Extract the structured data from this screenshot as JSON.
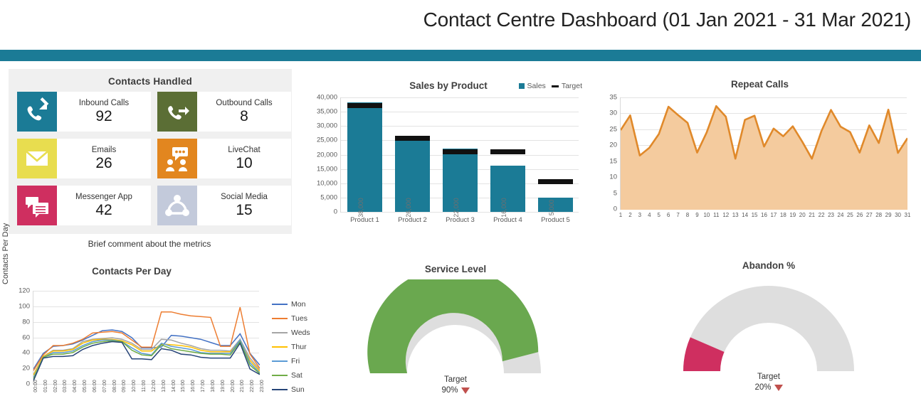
{
  "header": {
    "title": "Contact Centre Dashboard (01 Jan 2021 - 31 Mar 2021)",
    "bar_color": "#1b7b96"
  },
  "contacts_handled": {
    "title": "Contacts Handled",
    "comment": "Brief comment about the metrics",
    "tiles": [
      {
        "label": "Inbound Calls",
        "value": "92",
        "icon": "phone-inbound-icon",
        "color": "#1b7b96"
      },
      {
        "label": "Outbound Calls",
        "value": "8",
        "icon": "phone-outbound-icon",
        "color": "#5b6e35"
      },
      {
        "label": "Emails",
        "value": "26",
        "icon": "envelope-icon",
        "color": "#e8dd4f"
      },
      {
        "label": "LiveChat",
        "value": "10",
        "icon": "livechat-icon",
        "color": "#e2861f"
      },
      {
        "label": "Messenger App",
        "value": "42",
        "icon": "messenger-icon",
        "color": "#cf2f60"
      },
      {
        "label": "Social Media",
        "value": "15",
        "icon": "social-media-icon",
        "color": "#c3cadb"
      }
    ]
  },
  "chart_data": [
    {
      "id": "sales_by_product",
      "type": "bar",
      "title": "Sales by Product",
      "categories": [
        "Product 1",
        "Product 2",
        "Product 3",
        "Product 4",
        "Product 5"
      ],
      "series": [
        {
          "name": "Sales",
          "values": [
            38000,
            26000,
            22000,
            16000,
            5000
          ],
          "color": "#1b7b96"
        },
        {
          "name": "Target",
          "values": [
            37000,
            25500,
            20800,
            20800,
            10600
          ],
          "color": "#111111"
        }
      ],
      "data_labels": [
        "38,000",
        "26,000",
        "22,000",
        "16,000",
        "5,000"
      ],
      "ylabel": "",
      "xlabel": "",
      "ylim": [
        0,
        40000
      ],
      "yticks": [
        "0",
        "5,000",
        "10,000",
        "15,000",
        "20,000",
        "25,000",
        "30,000",
        "35,000",
        "40,000"
      ],
      "grid": true,
      "legend_position": "top-right"
    },
    {
      "id": "repeat_calls",
      "type": "area",
      "title": "Repeat Calls",
      "x": [
        "1",
        "2",
        "3",
        "4",
        "5",
        "6",
        "7",
        "8",
        "9",
        "10",
        "11",
        "12",
        "13",
        "14",
        "15",
        "16",
        "17",
        "18",
        "19",
        "20",
        "21",
        "22",
        "23",
        "24",
        "25",
        "26",
        "27",
        "28",
        "29",
        "30",
        "31"
      ],
      "values": [
        24.8,
        29.4,
        16.9,
        19.3,
        23.6,
        32.1,
        29.5,
        27.1,
        17.8,
        24.1,
        32.3,
        29.0,
        15.9,
        28.0,
        29.3,
        19.7,
        25.3,
        22.9,
        26.0,
        21.2,
        15.9,
        24.5,
        31.1,
        25.9,
        24.2,
        17.8,
        26.3,
        20.8,
        31.2,
        17.7,
        22.3
      ],
      "line_color": "#e0892a",
      "fill_color": "#f4cb9e",
      "ylabel": "",
      "xlabel": "",
      "ylim": [
        0,
        35
      ],
      "yticks": [
        "0",
        "5",
        "10",
        "15",
        "20",
        "25",
        "30",
        "35"
      ],
      "grid": true,
      "legend_position": "none"
    },
    {
      "id": "contacts_per_day",
      "type": "line",
      "title": "Contacts Per Day",
      "ylabel": "Contacts Per Day",
      "xlabel": "",
      "ylim": [
        0,
        120
      ],
      "yticks": [
        "0",
        "20",
        "40",
        "60",
        "80",
        "100",
        "120"
      ],
      "x": [
        "00:00",
        "01:00",
        "02:00",
        "03:00",
        "04:00",
        "05:00",
        "06:00",
        "07:00",
        "08:00",
        "09:00",
        "10:00",
        "11:00",
        "12:00",
        "13:00",
        "14:00",
        "15:00",
        "16:00",
        "17:00",
        "18:00",
        "19:00",
        "20:00",
        "21:00",
        "22:00",
        "23:00"
      ],
      "grid": true,
      "legend_position": "right",
      "series": [
        {
          "name": "Mon",
          "color": "#4472C4",
          "values": [
            20,
            40,
            49,
            50,
            52,
            57,
            63,
            69,
            70,
            68,
            60,
            47,
            47,
            48,
            63,
            62,
            60,
            58,
            54,
            50,
            50,
            65,
            40,
            25
          ]
        },
        {
          "name": "Tues",
          "color": "#ED7D31",
          "values": [
            18,
            38,
            50,
            50,
            53,
            58,
            66,
            67,
            68,
            66,
            57,
            48,
            48,
            93,
            93,
            90,
            88,
            87,
            86,
            49,
            49,
            99,
            39,
            21
          ]
        },
        {
          "name": "Weds",
          "color": "#A5A5A5",
          "values": [
            13,
            36,
            44,
            44,
            46,
            55,
            58,
            59,
            60,
            58,
            53,
            45,
            45,
            58,
            57,
            53,
            50,
            46,
            44,
            44,
            43,
            58,
            34,
            19
          ]
        },
        {
          "name": "Thur",
          "color": "#FFC000",
          "values": [
            12,
            36,
            43,
            43,
            45,
            53,
            57,
            58,
            58,
            56,
            51,
            43,
            43,
            52,
            51,
            50,
            48,
            44,
            42,
            42,
            42,
            55,
            31,
            17
          ]
        },
        {
          "name": "Fri",
          "color": "#5B9BD5",
          "values": [
            9,
            35,
            41,
            41,
            43,
            50,
            55,
            57,
            57,
            55,
            47,
            40,
            38,
            53,
            49,
            47,
            45,
            41,
            40,
            40,
            40,
            57,
            28,
            15
          ]
        },
        {
          "name": "Sat",
          "color": "#70AD47",
          "values": [
            7,
            35,
            39,
            39,
            41,
            48,
            53,
            55,
            56,
            55,
            44,
            38,
            37,
            51,
            46,
            44,
            42,
            40,
            39,
            39,
            38,
            55,
            25,
            14
          ]
        },
        {
          "name": "Sun",
          "color": "#264478",
          "values": [
            5,
            34,
            36,
            36,
            37,
            45,
            50,
            53,
            55,
            54,
            33,
            33,
            32,
            46,
            44,
            39,
            38,
            35,
            34,
            34,
            34,
            53,
            20,
            13
          ]
        }
      ]
    },
    {
      "id": "service_level",
      "type": "gauge",
      "title": "Service Level",
      "value": 92,
      "target_label": "Target",
      "target_value": "90%",
      "fill_color": "#6aa84f",
      "track_color": "#dedede",
      "target_marker_color": "#c0504d"
    },
    {
      "id": "abandon_pct",
      "type": "gauge",
      "title": "Abandon %",
      "value": 13,
      "target_label": "Target",
      "target_value": "20%",
      "fill_color": "#cf2f60",
      "track_color": "#dedede",
      "target_marker_color": "#c0504d"
    }
  ]
}
